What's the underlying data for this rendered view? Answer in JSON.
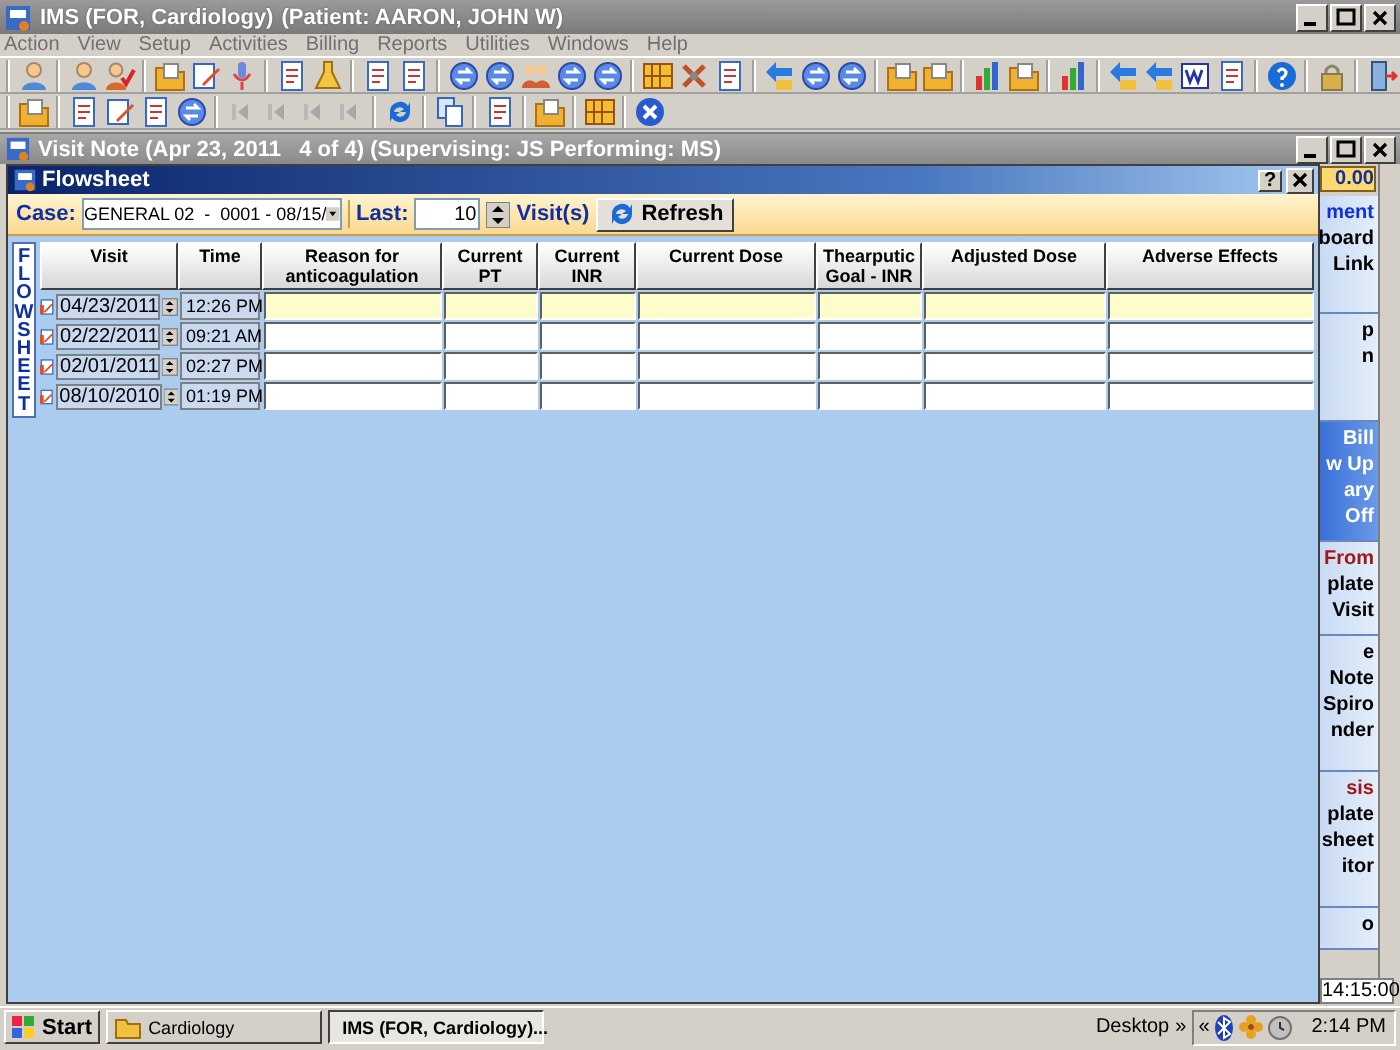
{
  "window": {
    "title": "IMS (FOR, Cardiology)",
    "patient": "(Patient: AARON, JOHN W)"
  },
  "menu": [
    "Action",
    "View",
    "Setup",
    "Activities",
    "Billing",
    "Reports",
    "Utilities",
    "Windows",
    "Help"
  ],
  "visit_note": {
    "title": "Visit Note (Apr 23, 2011   4 of 4) (Supervising: JS Performing: MS)"
  },
  "flowsheet": {
    "title": "Flowsheet",
    "help": "?",
    "case_label": "Case:",
    "case_value": "GENERAL 02  -  0001 - 08/15/",
    "last_label": "Last:",
    "last_value": "10",
    "visits_label": "Visit(s)",
    "refresh": "Refresh",
    "side_tab": "FLOWSHEET",
    "columns": [
      "Visit",
      "Time",
      "Reason for anticoagulation",
      "Current PT",
      "Current INR",
      "Current Dose",
      "Thearputic Goal - INR",
      "Adjusted Dose",
      "Adverse Effects"
    ],
    "rows": [
      {
        "visit": "04/23/2011",
        "time": "12:26 PM",
        "selected": true
      },
      {
        "visit": "02/22/2011",
        "time": "09:21 AM",
        "selected": false
      },
      {
        "visit": "02/01/2011",
        "time": "02:27 PM",
        "selected": false
      },
      {
        "visit": "08/10/2010",
        "time": "01:19 PM",
        "selected": false
      }
    ]
  },
  "side_panel": {
    "amount": "0.00",
    "time": "14:15:00",
    "groups": [
      {
        "kind": "plain",
        "items": [
          {
            "text": "ment",
            "kind": "link"
          },
          {
            "text": "board",
            "kind": "plain"
          },
          {
            "text": "Link",
            "kind": "plain"
          }
        ]
      },
      {
        "kind": "plain",
        "items": [
          {
            "text": "p",
            "kind": "plain"
          },
          {
            "text": "n",
            "kind": "plain"
          }
        ]
      },
      {
        "kind": "highlighted",
        "items": [
          {
            "text": "Bill",
            "kind": "plain"
          },
          {
            "text": "w Up",
            "kind": "plain"
          },
          {
            "text": "ary",
            "kind": "plain"
          },
          {
            "text": "Off",
            "kind": "plain"
          }
        ]
      },
      {
        "kind": "plain",
        "items": [
          {
            "text": "From",
            "kind": "heading"
          },
          {
            "text": "plate",
            "kind": "plain"
          },
          {
            "text": "Visit",
            "kind": "plain"
          }
        ]
      },
      {
        "kind": "plain",
        "items": [
          {
            "text": "e",
            "kind": "plain"
          },
          {
            "text": "Note",
            "kind": "plain"
          },
          {
            "text": "Spiro",
            "kind": "plain"
          },
          {
            "text": "nder",
            "kind": "plain"
          }
        ]
      },
      {
        "kind": "plain",
        "items": [
          {
            "text": "sis",
            "kind": "heading"
          },
          {
            "text": "plate",
            "kind": "plain"
          },
          {
            "text": "sheet",
            "kind": "plain"
          },
          {
            "text": "itor",
            "kind": "plain"
          }
        ]
      },
      {
        "kind": "plain",
        "items": [
          {
            "text": "o",
            "kind": "plain"
          }
        ]
      }
    ]
  },
  "taskbar": {
    "start": "Start",
    "tasks": [
      {
        "label": "Cardiology",
        "active": false
      },
      {
        "label": "IMS (FOR, Cardiology)...",
        "active": true
      }
    ],
    "desktop": "Desktop",
    "chevron": "»",
    "tray_chevron": "«",
    "clock": "2:14 PM"
  }
}
